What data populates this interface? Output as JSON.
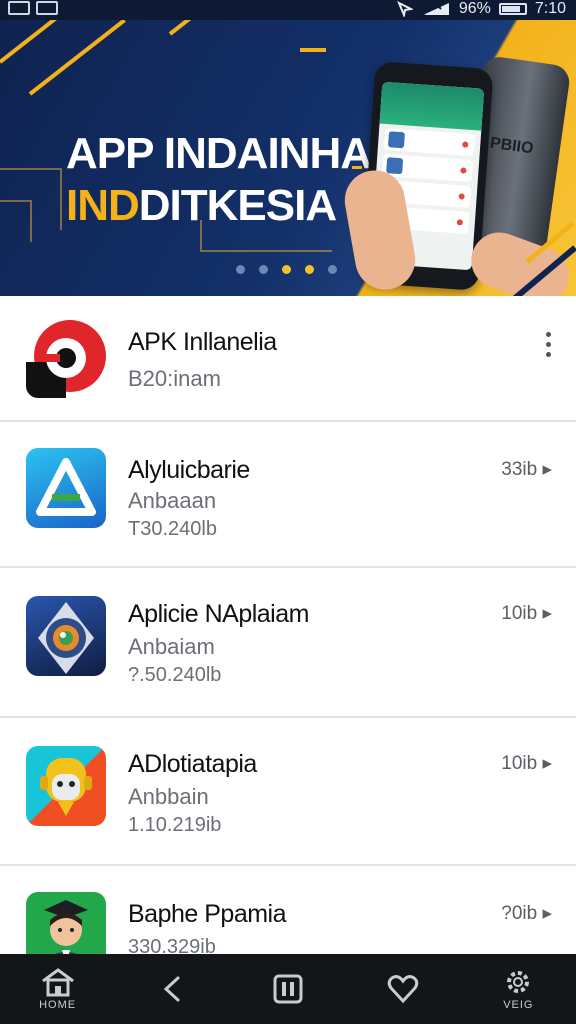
{
  "status_bar": {
    "battery_percent": "96%",
    "time": "7:10",
    "icons": [
      "image-icon",
      "gallery-icon",
      "location-icon",
      "signal-icon",
      "battery-icon"
    ]
  },
  "banner": {
    "title_line1": "APP INDAINHA",
    "title_line2_part1": "IND",
    "title_line2_part2": "DITKESIA",
    "phone_back_text": "PBIIO",
    "carousel_dots": 5,
    "active_dot": 2,
    "colors": {
      "navy": "#0f2350",
      "accent": "#f3b21a"
    }
  },
  "apps": [
    {
      "name": "APK Inllanelia",
      "subtitle": "B20:inam",
      "meta": "",
      "size": "",
      "icon": "red-circle-logo-icon",
      "has_menu": true
    },
    {
      "name": "Alyluicbarie",
      "subtitle": "Anbaaan",
      "meta": "T30.240lb",
      "size": "33ib",
      "icon": "blue-triangle-logo-icon",
      "has_menu": false
    },
    {
      "name": "Aplicie NAplaiam",
      "subtitle": "Anbaiam",
      "meta": "?.50.240lb",
      "size": "10ib",
      "icon": "camera-lens-logo-icon",
      "has_menu": false
    },
    {
      "name": "ADlotiatapia",
      "subtitle": "Anbbain",
      "meta": "1.10.219ib",
      "size": "10ib",
      "icon": "robot-face-logo-icon",
      "has_menu": false
    },
    {
      "name": "Baphe Ppamia",
      "subtitle": "",
      "meta": "330.329ib",
      "size": "?0ib",
      "icon": "person-avatar-logo-icon",
      "has_menu": false
    }
  ],
  "bottom_nav": [
    {
      "label": "HOME",
      "icon": "home-icon"
    },
    {
      "label": "",
      "icon": "back-icon"
    },
    {
      "label": "",
      "icon": "apps-icon"
    },
    {
      "label": "",
      "icon": "heart-icon"
    },
    {
      "label": "VEIG",
      "icon": "settings-gear-icon"
    }
  ]
}
